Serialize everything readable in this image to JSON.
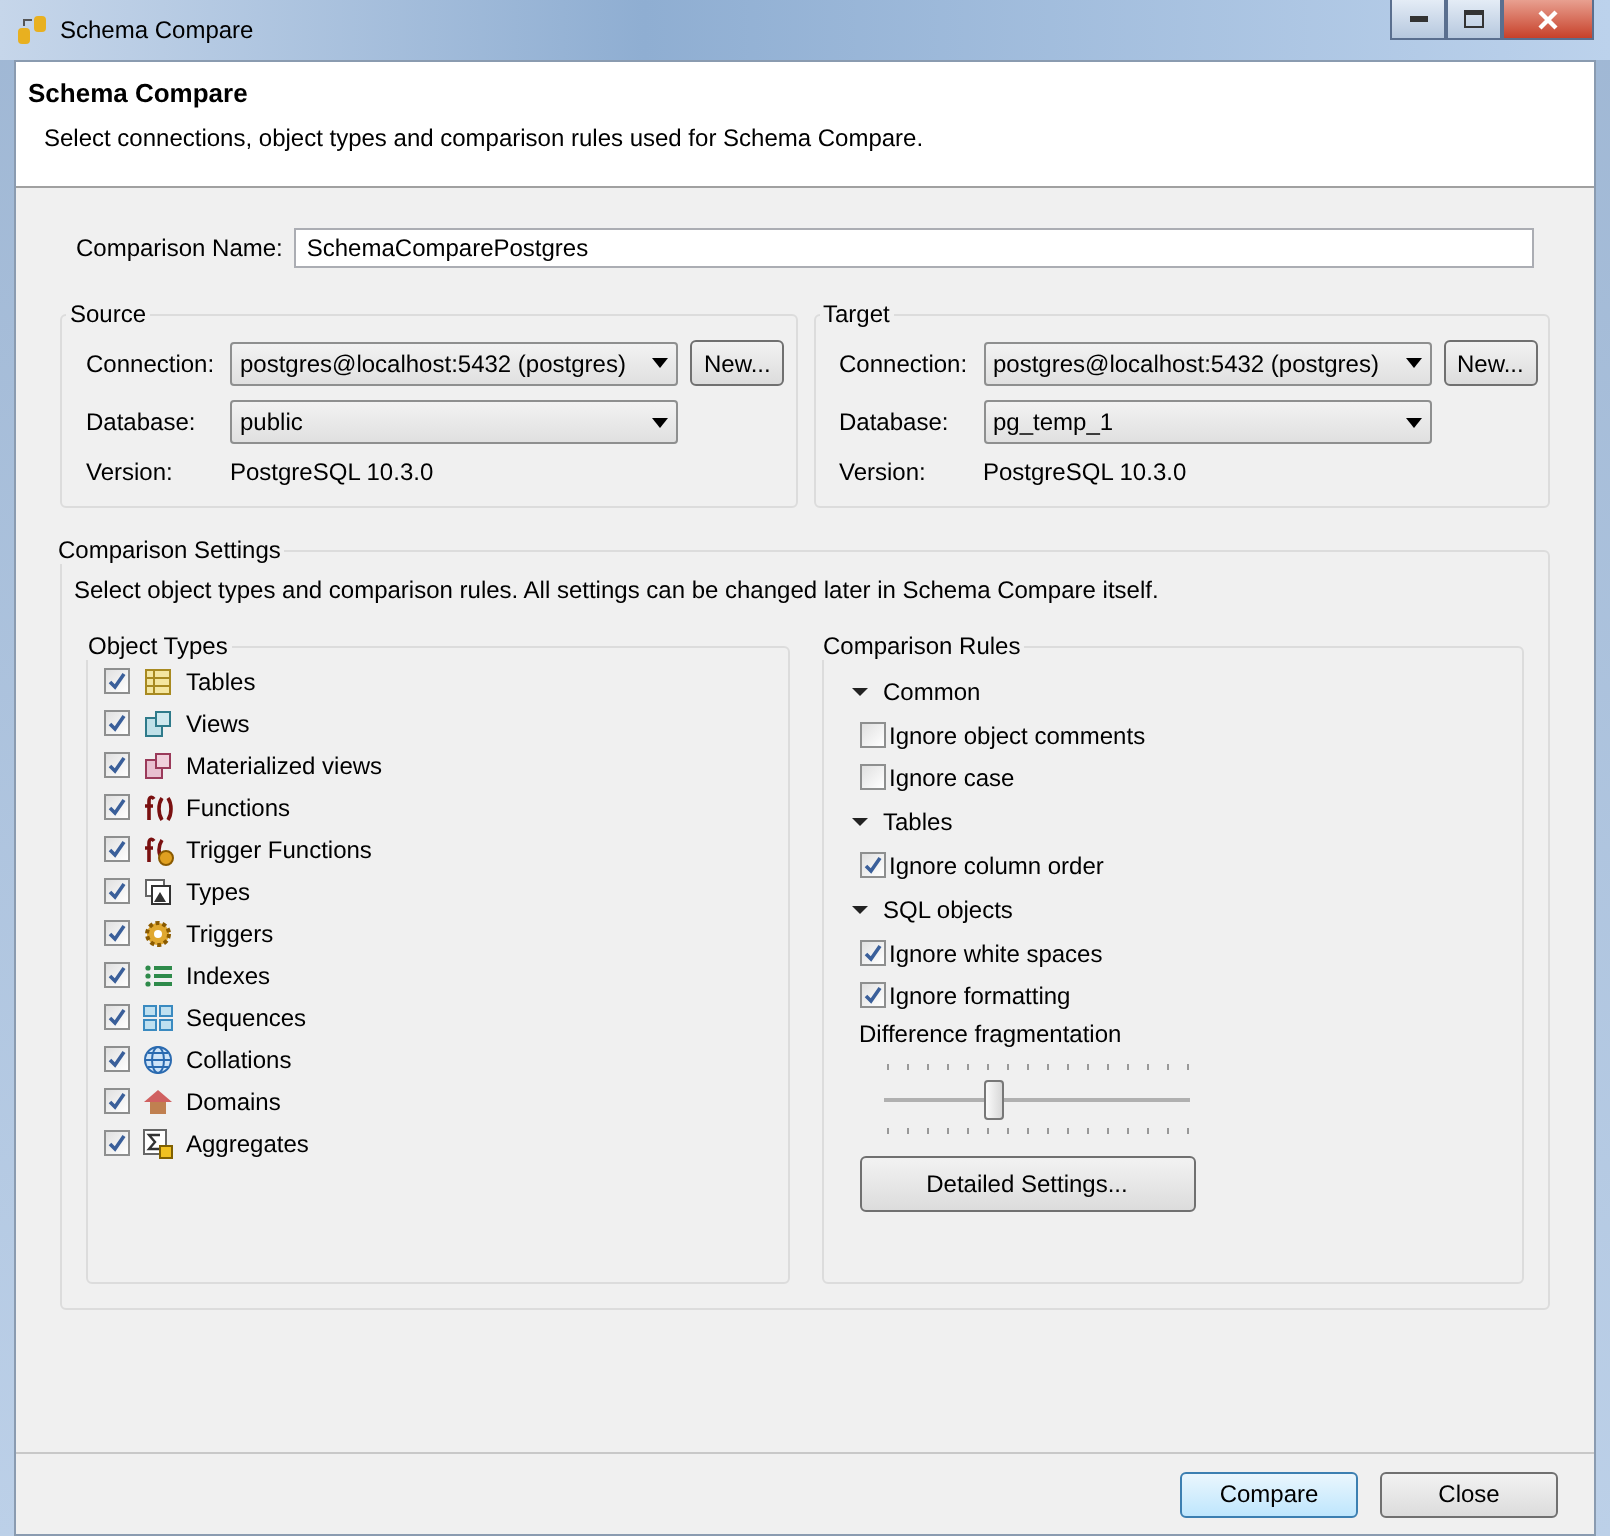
{
  "window": {
    "title": "Schema Compare"
  },
  "header": {
    "title": "Schema Compare",
    "description": "Select connections, object types and comparison rules used for Schema Compare."
  },
  "comparison_name": {
    "label": "Comparison Name:",
    "value": "SchemaComparePostgres"
  },
  "connections": [
    {
      "title": "Source",
      "connection_label": "Connection:",
      "connection": "postgres@localhost:5432 (postgres)",
      "new_button": "New...",
      "database_label": "Database:",
      "database": "public",
      "version_label": "Version:",
      "version": "PostgreSQL 10.3.0"
    },
    {
      "title": "Target",
      "connection_label": "Connection:",
      "connection": "postgres@localhost:5432 (postgres)",
      "new_button": "New...",
      "database_label": "Database:",
      "database": "pg_temp_1",
      "version_label": "Version:",
      "version": "PostgreSQL 10.3.0"
    }
  ],
  "settings": {
    "title": "Comparison Settings",
    "description": "Select object types and comparison rules. All settings can be changed later in Schema Compare itself.",
    "object_types": {
      "title": "Object Types",
      "items": [
        {
          "label": "Tables",
          "checked": true
        },
        {
          "label": "Views",
          "checked": true
        },
        {
          "label": "Materialized views",
          "checked": true
        },
        {
          "label": "Functions",
          "checked": true
        },
        {
          "label": "Trigger Functions",
          "checked": true
        },
        {
          "label": "Types",
          "checked": true
        },
        {
          "label": "Triggers",
          "checked": true
        },
        {
          "label": "Indexes",
          "checked": true
        },
        {
          "label": "Sequences",
          "checked": true
        },
        {
          "label": "Collations",
          "checked": true
        },
        {
          "label": "Domains",
          "checked": true
        },
        {
          "label": "Aggregates",
          "checked": true
        }
      ]
    },
    "rules": {
      "title": "Comparison Rules",
      "groups": [
        {
          "label": "Common",
          "expanded": true,
          "items": [
            {
              "label": "Ignore object comments",
              "checked": false
            },
            {
              "label": "Ignore case",
              "checked": false
            }
          ]
        },
        {
          "label": "Tables",
          "expanded": true,
          "items": [
            {
              "label": "Ignore column order",
              "checked": true
            }
          ]
        },
        {
          "label": "SQL objects",
          "expanded": true,
          "items": [
            {
              "label": "Ignore white spaces",
              "checked": true
            },
            {
              "label": "Ignore formatting",
              "checked": true
            }
          ]
        }
      ],
      "fragmentation": {
        "label": "Difference fragmentation",
        "level": 0.35
      },
      "detailed_button": "Detailed Settings..."
    }
  },
  "buttons": [
    {
      "label": "Compare",
      "selected": true
    },
    {
      "label": "Close",
      "selected": false
    }
  ]
}
